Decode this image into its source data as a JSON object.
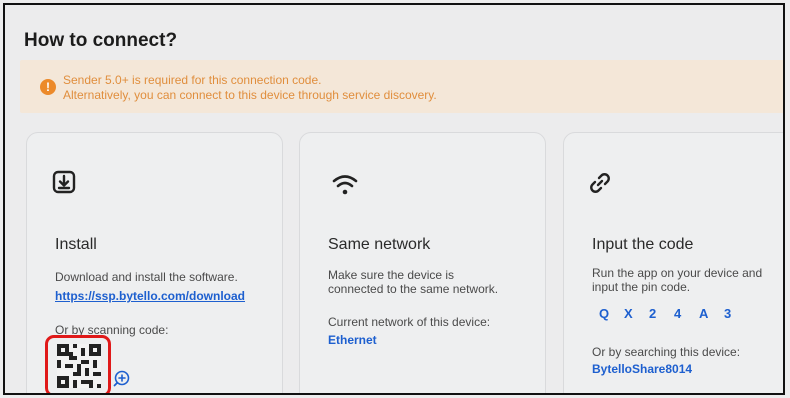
{
  "page": {
    "title": "How to connect?"
  },
  "banner": {
    "line1": "Sender 5.0+ is required for this connection code.",
    "line2": "Alternatively, you can connect to this device through service discovery.",
    "icon": "warning-icon"
  },
  "cards": {
    "install": {
      "icon": "download-icon",
      "heading": "Install",
      "desc": "Download and install the software.",
      "link": "https://ssp.bytello.com/download",
      "scan_label": "Or by scanning code:",
      "qr_icon": "qr-code-icon",
      "zoom_icon": "zoom-in-icon"
    },
    "network": {
      "icon": "wifi-icon",
      "heading": "Same network",
      "desc_line1": "Make sure the device is",
      "desc_line2": "connected to the same network.",
      "current_label": "Current network of this device:",
      "current_value": "Ethernet"
    },
    "code": {
      "icon": "link-icon",
      "heading": "Input the code",
      "desc_line1": "Run the app on your device and",
      "desc_line2": "input the pin code.",
      "pin": [
        "Q",
        "X",
        "2",
        "4",
        "A",
        "3"
      ],
      "search_label": "Or by searching this device:",
      "device_name": "BytelloShare8014"
    }
  },
  "colors": {
    "accent": "#1d5fcf",
    "warning": "#ec8a2a",
    "highlight": "#e01919"
  }
}
